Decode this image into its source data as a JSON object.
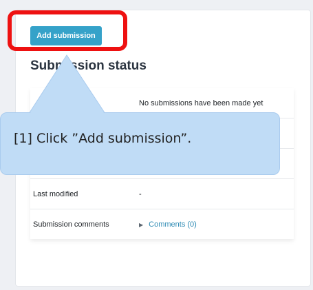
{
  "actions": {
    "add_submission_label": "Add submission"
  },
  "status": {
    "title": "Submission status",
    "rows": [
      {
        "label": "",
        "value": "No submissions have been made yet"
      },
      {
        "label": "",
        "value": ""
      },
      {
        "label": "",
        "value": ""
      },
      {
        "label": "Last modified",
        "value": "-"
      },
      {
        "label": "Submission comments",
        "value": "Comments (0)"
      }
    ]
  },
  "callout": {
    "text": "[1] Click ”Add submission”."
  },
  "colors": {
    "accent": "#35a2c9",
    "highlight": "#ee1111",
    "callout_bg": "#c0dcf6",
    "link": "#2e8bb4"
  },
  "icons": {
    "comments_expander": "triangle-right-icon"
  }
}
